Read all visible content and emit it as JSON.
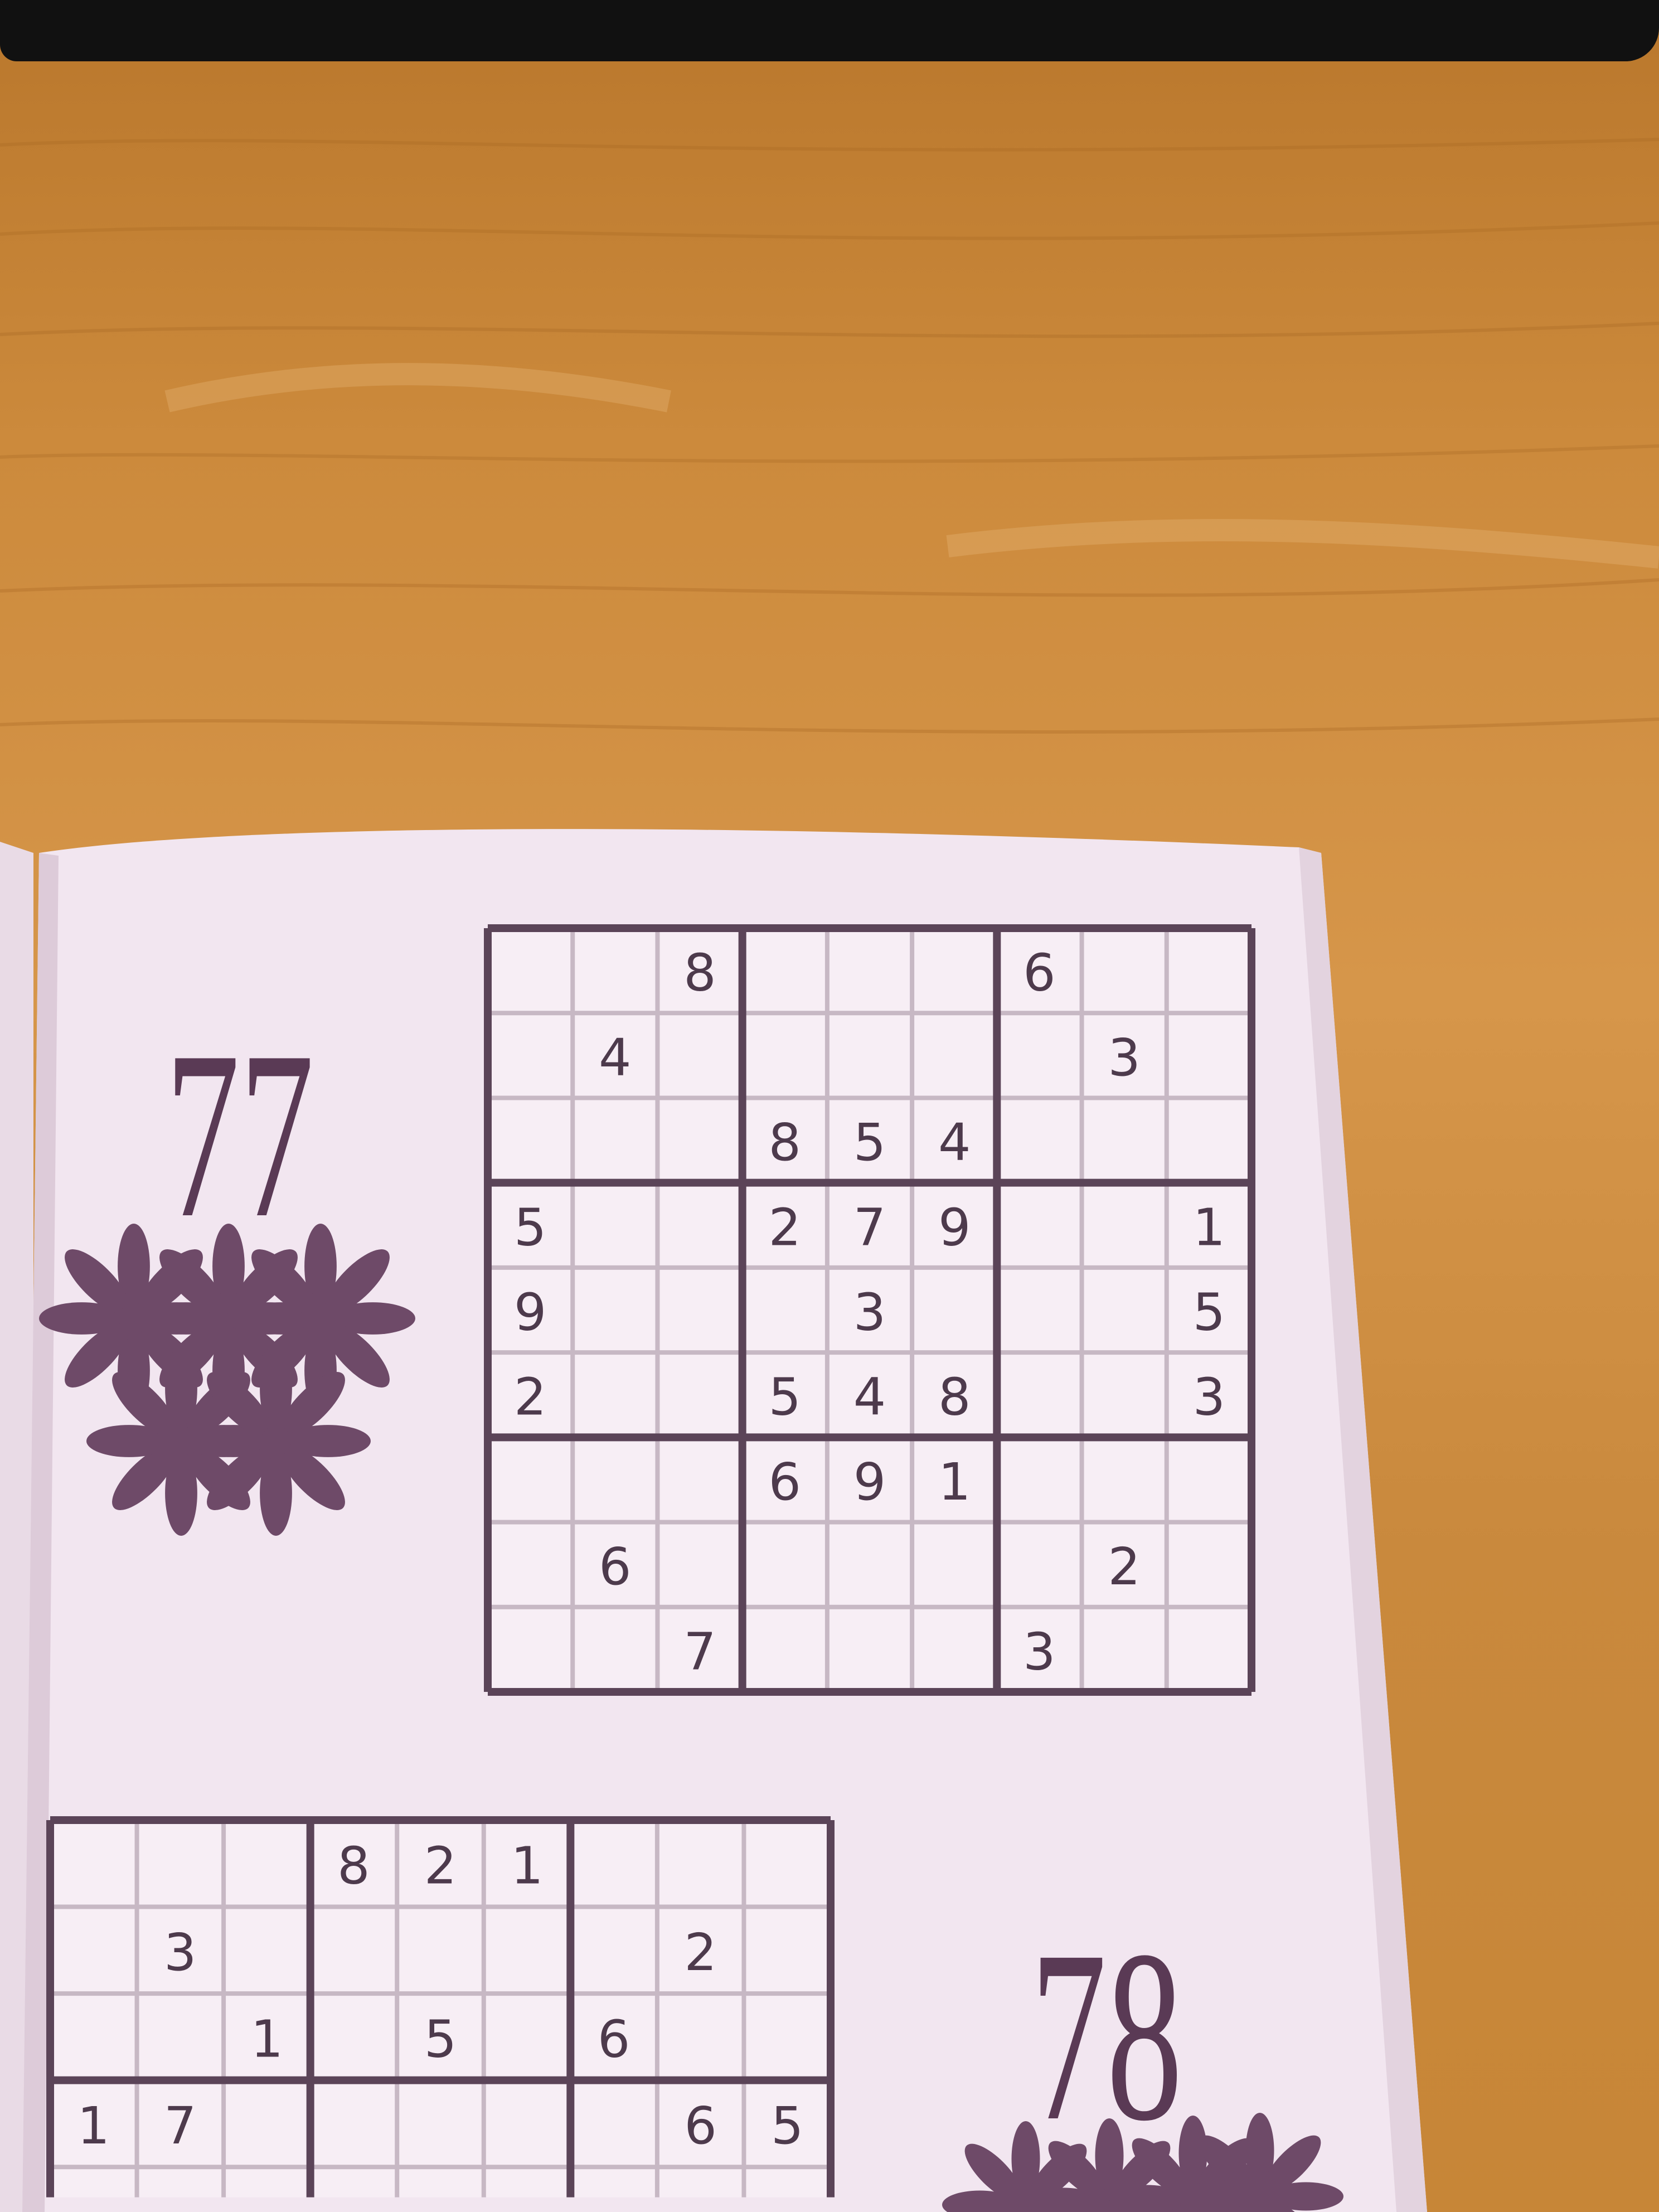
{
  "puzzle_77": {
    "number": "77",
    "difficulty_stars": 5,
    "givens": [
      [
        "",
        "",
        "8",
        "",
        "",
        "",
        "6",
        "",
        ""
      ],
      [
        "",
        "4",
        "",
        "",
        "",
        "",
        "",
        "3",
        ""
      ],
      [
        "",
        "",
        "",
        "8",
        "5",
        "4",
        "",
        "",
        ""
      ],
      [
        "5",
        "",
        "",
        "2",
        "7",
        "9",
        "",
        "",
        "1"
      ],
      [
        "9",
        "",
        "",
        "",
        "3",
        "",
        "",
        "",
        "5"
      ],
      [
        "2",
        "",
        "",
        "5",
        "4",
        "8",
        "",
        "",
        "3"
      ],
      [
        "",
        "",
        "",
        "6",
        "9",
        "1",
        "",
        "",
        ""
      ],
      [
        "",
        "6",
        "",
        "",
        "",
        "",
        "",
        "2",
        ""
      ],
      [
        "",
        "",
        "7",
        "",
        "",
        "",
        "3",
        "",
        ""
      ]
    ]
  },
  "puzzle_78": {
    "number": "78",
    "visible_givens": [
      [
        "",
        "",
        "",
        "8",
        "2",
        "1",
        "",
        "",
        ""
      ],
      [
        "",
        "3",
        "",
        "",
        "",
        "",
        "",
        "2",
        ""
      ],
      [
        "",
        "",
        "1",
        "",
        "5",
        "",
        "6",
        "",
        ""
      ],
      [
        "1",
        "7",
        "",
        "",
        "",
        "",
        "",
        "6",
        "5"
      ]
    ]
  },
  "colors": {
    "wood": "#cc8a3c",
    "page": "#f2e6f0",
    "ink": "#4d3a4c",
    "grid_thick": "#5b4458",
    "grid_thin": "#c7b8c4"
  }
}
